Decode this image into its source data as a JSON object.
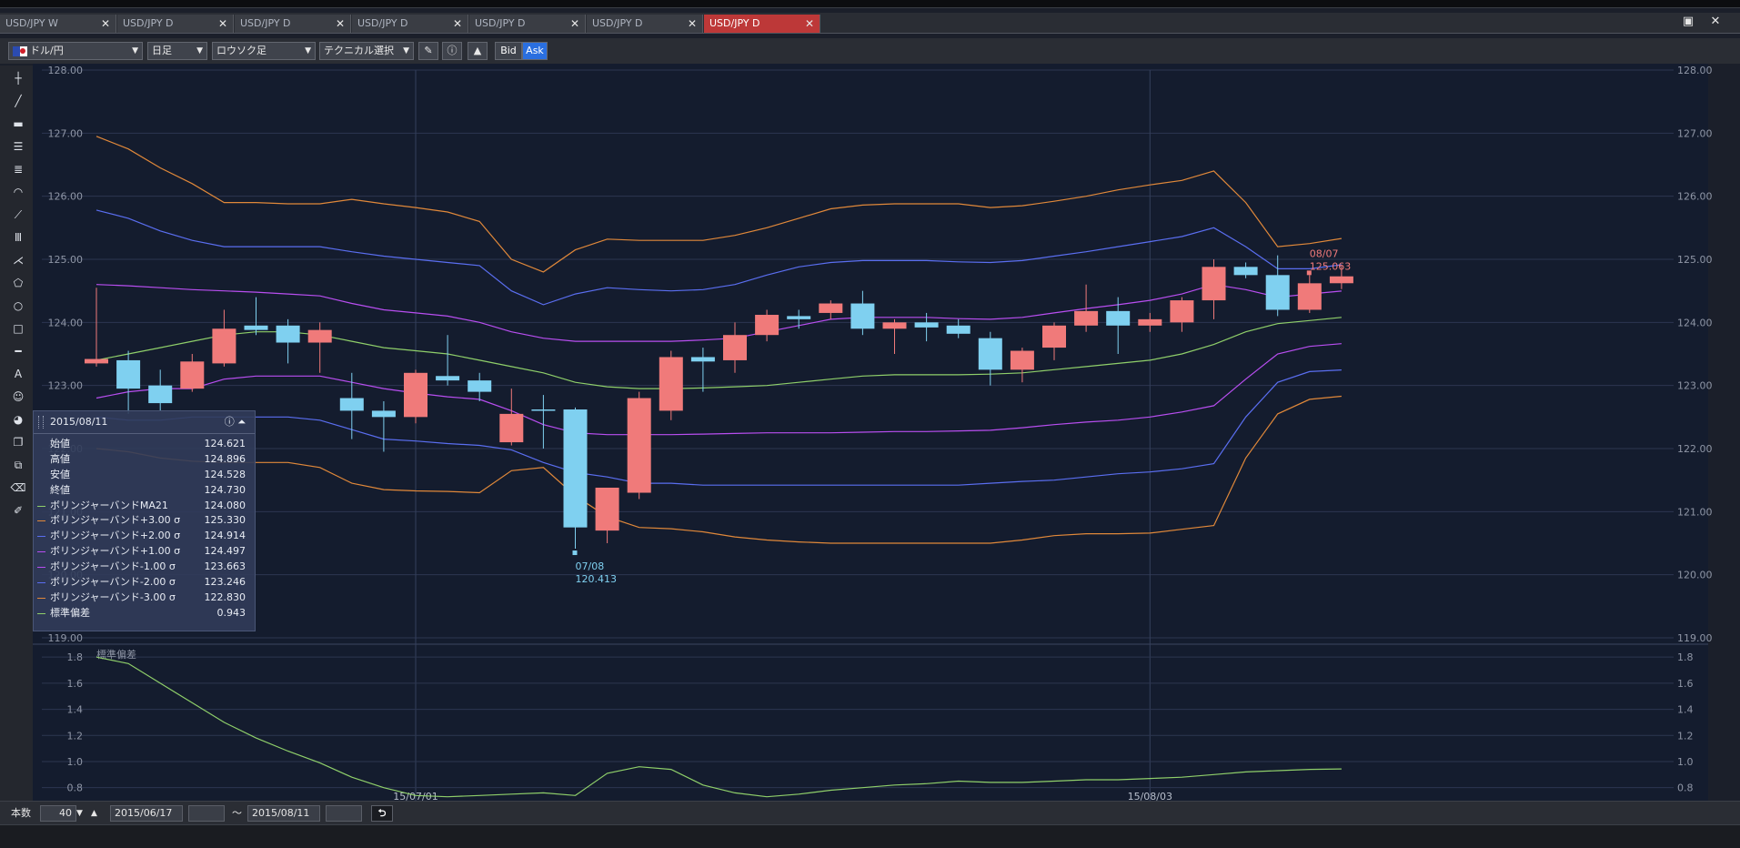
{
  "tabs": [
    {
      "label": "USD/JPY W",
      "active": false
    },
    {
      "label": "USD/JPY D",
      "active": false
    },
    {
      "label": "USD/JPY D",
      "active": false
    },
    {
      "label": "USD/JPY D",
      "active": false
    },
    {
      "label": "USD/JPY D",
      "active": false
    },
    {
      "label": "USD/JPY D",
      "active": false
    },
    {
      "label": "USD/JPY D",
      "active": true
    }
  ],
  "toolbar": {
    "pair": "ドル/円",
    "timeframe": "日足",
    "chart_type": "ロウソク足",
    "technical": "テクニカル選択",
    "bid": "Bid",
    "ask": "Ask"
  },
  "info_panel": {
    "date": "2015/08/11",
    "ohlc": [
      {
        "label": "始値",
        "value": "124.621"
      },
      {
        "label": "高値",
        "value": "124.896"
      },
      {
        "label": "安値",
        "value": "124.528"
      },
      {
        "label": "終値",
        "value": "124.730"
      }
    ],
    "indicators": [
      {
        "label": "ボリンジャーバンドMA21",
        "value": "124.080",
        "color": "#8fcf6a"
      },
      {
        "label": "ボリンジャーバンド+3.00 σ",
        "value": "125.330",
        "color": "#e0883a"
      },
      {
        "label": "ボリンジャーバンド+2.00 σ",
        "value": "124.914",
        "color": "#5a6ef0"
      },
      {
        "label": "ボリンジャーバンド+1.00 σ",
        "value": "124.497",
        "color": "#b84ef0"
      },
      {
        "label": "ボリンジャーバンド-1.00 σ",
        "value": "123.663",
        "color": "#b84ef0"
      },
      {
        "label": "ボリンジャーバンド-2.00 σ",
        "value": "123.246",
        "color": "#5a6ef0"
      },
      {
        "label": "ボリンジャーバンド-3.00 σ",
        "value": "122.830",
        "color": "#e0883a"
      },
      {
        "label": "標準偏差",
        "value": "0.943",
        "color": "#8fcf6a"
      }
    ]
  },
  "bottom": {
    "count_label": "本数",
    "count_value": "40",
    "from_date": "2015/06/17",
    "tilde": "～",
    "to_date": "2015/08/11"
  },
  "colors": {
    "up": "#f07a7a",
    "down": "#7fd0f0",
    "ma": "#8fcf6a",
    "sigma1": "#b84ef0",
    "sigma2": "#5a6ef0",
    "sigma3": "#e0883a",
    "background": "#141c2e"
  },
  "chart_data": [
    {
      "type": "candlestick",
      "y_ticks": [
        "128.00",
        "127.00",
        "126.00",
        "125.00",
        "124.00",
        "123.00",
        "122.00",
        "121.00",
        "120.00",
        "119.00"
      ],
      "ylim": [
        119,
        128
      ],
      "x_tick_labels": [
        {
          "label": "15/07/01",
          "index": 10
        },
        {
          "label": "15/08/03",
          "index": 33
        }
      ],
      "annotations": [
        {
          "date": "07/08",
          "value": "120.413",
          "type": "low",
          "index": 15
        },
        {
          "date": "08/07",
          "value": "125.063",
          "type": "high",
          "index": 38
        }
      ],
      "candles": [
        {
          "o": 123.35,
          "h": 124.55,
          "l": 123.3,
          "c": 123.42
        },
        {
          "o": 123.4,
          "h": 123.55,
          "l": 122.55,
          "c": 122.95
        },
        {
          "o": 123.0,
          "h": 123.25,
          "l": 122.6,
          "c": 122.72
        },
        {
          "o": 122.95,
          "h": 123.5,
          "l": 122.9,
          "c": 123.38
        },
        {
          "o": 123.35,
          "h": 124.2,
          "l": 123.3,
          "c": 123.9
        },
        {
          "o": 123.95,
          "h": 124.4,
          "l": 123.8,
          "c": 123.88
        },
        {
          "o": 123.95,
          "h": 124.05,
          "l": 123.35,
          "c": 123.68
        },
        {
          "o": 123.68,
          "h": 124.0,
          "l": 123.2,
          "c": 123.88
        },
        {
          "o": 122.8,
          "h": 123.2,
          "l": 122.15,
          "c": 122.6
        },
        {
          "o": 122.6,
          "h": 122.75,
          "l": 121.95,
          "c": 122.5
        },
        {
          "o": 122.5,
          "h": 123.25,
          "l": 122.4,
          "c": 123.2
        },
        {
          "o": 123.15,
          "h": 123.8,
          "l": 123.0,
          "c": 123.08
        },
        {
          "o": 123.08,
          "h": 123.2,
          "l": 122.75,
          "c": 122.9
        },
        {
          "o": 122.1,
          "h": 122.95,
          "l": 122.05,
          "c": 122.55
        },
        {
          "o": 122.62,
          "h": 122.85,
          "l": 122.0,
          "c": 122.6
        },
        {
          "o": 122.62,
          "h": 122.65,
          "l": 120.413,
          "c": 120.75
        },
        {
          "o": 120.7,
          "h": 121.3,
          "l": 120.5,
          "c": 121.38
        },
        {
          "o": 121.3,
          "h": 122.9,
          "l": 121.2,
          "c": 122.8
        },
        {
          "o": 122.6,
          "h": 123.55,
          "l": 122.45,
          "c": 123.45
        },
        {
          "o": 123.45,
          "h": 123.6,
          "l": 122.9,
          "c": 123.38
        },
        {
          "o": 123.4,
          "h": 124.0,
          "l": 123.2,
          "c": 123.8
        },
        {
          "o": 123.8,
          "h": 124.2,
          "l": 123.7,
          "c": 124.12
        },
        {
          "o": 124.1,
          "h": 124.2,
          "l": 123.9,
          "c": 124.05
        },
        {
          "o": 124.15,
          "h": 124.35,
          "l": 124.05,
          "c": 124.3
        },
        {
          "o": 124.3,
          "h": 124.5,
          "l": 123.8,
          "c": 123.9
        },
        {
          "o": 123.9,
          "h": 124.05,
          "l": 123.5,
          "c": 124.0
        },
        {
          "o": 124.0,
          "h": 124.15,
          "l": 123.7,
          "c": 123.92
        },
        {
          "o": 123.95,
          "h": 124.05,
          "l": 123.75,
          "c": 123.82
        },
        {
          "o": 123.75,
          "h": 123.85,
          "l": 123.0,
          "c": 123.25
        },
        {
          "o": 123.25,
          "h": 123.6,
          "l": 123.05,
          "c": 123.55
        },
        {
          "o": 123.6,
          "h": 124.0,
          "l": 123.4,
          "c": 123.95
        },
        {
          "o": 123.95,
          "h": 124.6,
          "l": 123.85,
          "c": 124.18
        },
        {
          "o": 124.18,
          "h": 124.4,
          "l": 123.5,
          "c": 123.95
        },
        {
          "o": 123.95,
          "h": 124.15,
          "l": 123.85,
          "c": 124.05
        },
        {
          "o": 124.0,
          "h": 124.4,
          "l": 123.85,
          "c": 124.35
        },
        {
          "o": 124.35,
          "h": 125.0,
          "l": 124.05,
          "c": 124.88
        },
        {
          "o": 124.88,
          "h": 124.95,
          "l": 124.7,
          "c": 124.75
        },
        {
          "o": 124.75,
          "h": 125.063,
          "l": 124.1,
          "c": 124.2
        },
        {
          "o": 124.2,
          "h": 124.75,
          "l": 124.15,
          "c": 124.62
        },
        {
          "o": 124.621,
          "h": 124.896,
          "l": 124.528,
          "c": 124.73
        }
      ],
      "series": [
        {
          "key": "ma",
          "values": [
            123.4,
            123.5,
            123.6,
            123.7,
            123.8,
            123.85,
            123.85,
            123.8,
            123.7,
            123.6,
            123.55,
            123.5,
            123.4,
            123.3,
            123.2,
            123.05,
            122.98,
            122.95,
            122.95,
            122.96,
            122.98,
            123.0,
            123.05,
            123.1,
            123.15,
            123.17,
            123.17,
            123.17,
            123.18,
            123.2,
            123.25,
            123.3,
            123.35,
            123.4,
            123.5,
            123.65,
            123.85,
            123.98,
            124.03,
            124.08
          ]
        },
        {
          "key": "p1",
          "values": [
            124.6,
            124.58,
            124.55,
            124.52,
            124.5,
            124.48,
            124.45,
            124.42,
            124.3,
            124.2,
            124.15,
            124.1,
            124.0,
            123.85,
            123.75,
            123.7,
            123.7,
            123.7,
            123.7,
            123.72,
            123.75,
            123.85,
            123.95,
            124.05,
            124.08,
            124.08,
            124.08,
            124.06,
            124.05,
            124.08,
            124.15,
            124.22,
            124.28,
            124.35,
            124.45,
            124.6,
            124.52,
            124.4,
            124.45,
            124.497
          ]
        },
        {
          "key": "p2",
          "values": [
            125.78,
            125.65,
            125.45,
            125.3,
            125.2,
            125.2,
            125.2,
            125.2,
            125.12,
            125.05,
            125.0,
            124.95,
            124.9,
            124.5,
            124.28,
            124.45,
            124.55,
            124.52,
            124.5,
            124.52,
            124.6,
            124.75,
            124.88,
            124.95,
            124.98,
            124.98,
            124.98,
            124.96,
            124.95,
            124.98,
            125.05,
            125.12,
            125.2,
            125.28,
            125.36,
            125.5,
            125.2,
            124.85,
            124.85,
            124.914
          ]
        },
        {
          "key": "p3",
          "values": [
            126.95,
            126.75,
            126.45,
            126.2,
            125.9,
            125.9,
            125.88,
            125.88,
            125.95,
            125.88,
            125.82,
            125.75,
            125.6,
            125.0,
            124.8,
            125.15,
            125.32,
            125.3,
            125.3,
            125.3,
            125.38,
            125.5,
            125.65,
            125.8,
            125.86,
            125.88,
            125.88,
            125.88,
            125.82,
            125.85,
            125.92,
            126.0,
            126.1,
            126.18,
            126.25,
            126.4,
            125.9,
            125.2,
            125.25,
            125.33
          ]
        },
        {
          "key": "m1",
          "values": [
            122.8,
            122.9,
            122.95,
            122.95,
            123.1,
            123.15,
            123.15,
            123.15,
            123.05,
            122.95,
            122.88,
            122.82,
            122.78,
            122.6,
            122.38,
            122.25,
            122.22,
            122.22,
            122.22,
            122.23,
            122.24,
            122.25,
            122.25,
            122.25,
            122.26,
            122.27,
            122.27,
            122.28,
            122.29,
            122.33,
            122.38,
            122.42,
            122.45,
            122.5,
            122.58,
            122.68,
            123.1,
            123.5,
            123.62,
            123.663
          ]
        },
        {
          "key": "m2",
          "values": [
            122.5,
            122.45,
            122.45,
            122.5,
            122.5,
            122.5,
            122.5,
            122.45,
            122.3,
            122.15,
            122.12,
            122.08,
            122.05,
            121.98,
            121.78,
            121.62,
            121.55,
            121.45,
            121.45,
            121.42,
            121.42,
            121.42,
            121.42,
            121.42,
            121.42,
            121.42,
            121.42,
            121.42,
            121.45,
            121.48,
            121.5,
            121.55,
            121.6,
            121.63,
            121.68,
            121.76,
            122.5,
            123.05,
            123.22,
            123.246
          ]
        },
        {
          "key": "m3",
          "values": [
            122.0,
            121.95,
            121.85,
            121.8,
            121.78,
            121.78,
            121.78,
            121.7,
            121.45,
            121.35,
            121.33,
            121.32,
            121.3,
            121.65,
            121.7,
            121.25,
            120.92,
            120.75,
            120.73,
            120.68,
            120.6,
            120.55,
            120.52,
            120.5,
            120.5,
            120.5,
            120.5,
            120.5,
            120.5,
            120.55,
            120.62,
            120.65,
            120.65,
            120.66,
            120.72,
            120.78,
            121.85,
            122.55,
            122.78,
            122.83
          ]
        }
      ]
    },
    {
      "type": "line",
      "title": "標準偏差",
      "y_ticks": [
        "1.8",
        "1.6",
        "1.4",
        "1.2",
        "1.0",
        "0.8"
      ],
      "ylim": [
        0.7,
        1.85
      ],
      "values": [
        1.8,
        1.75,
        1.6,
        1.45,
        1.3,
        1.18,
        1.08,
        0.99,
        0.88,
        0.8,
        0.74,
        0.73,
        0.74,
        0.75,
        0.76,
        0.74,
        0.91,
        0.96,
        0.94,
        0.82,
        0.76,
        0.73,
        0.75,
        0.78,
        0.8,
        0.82,
        0.83,
        0.85,
        0.84,
        0.84,
        0.85,
        0.86,
        0.86,
        0.87,
        0.88,
        0.9,
        0.92,
        0.93,
        0.94,
        0.943
      ]
    }
  ]
}
